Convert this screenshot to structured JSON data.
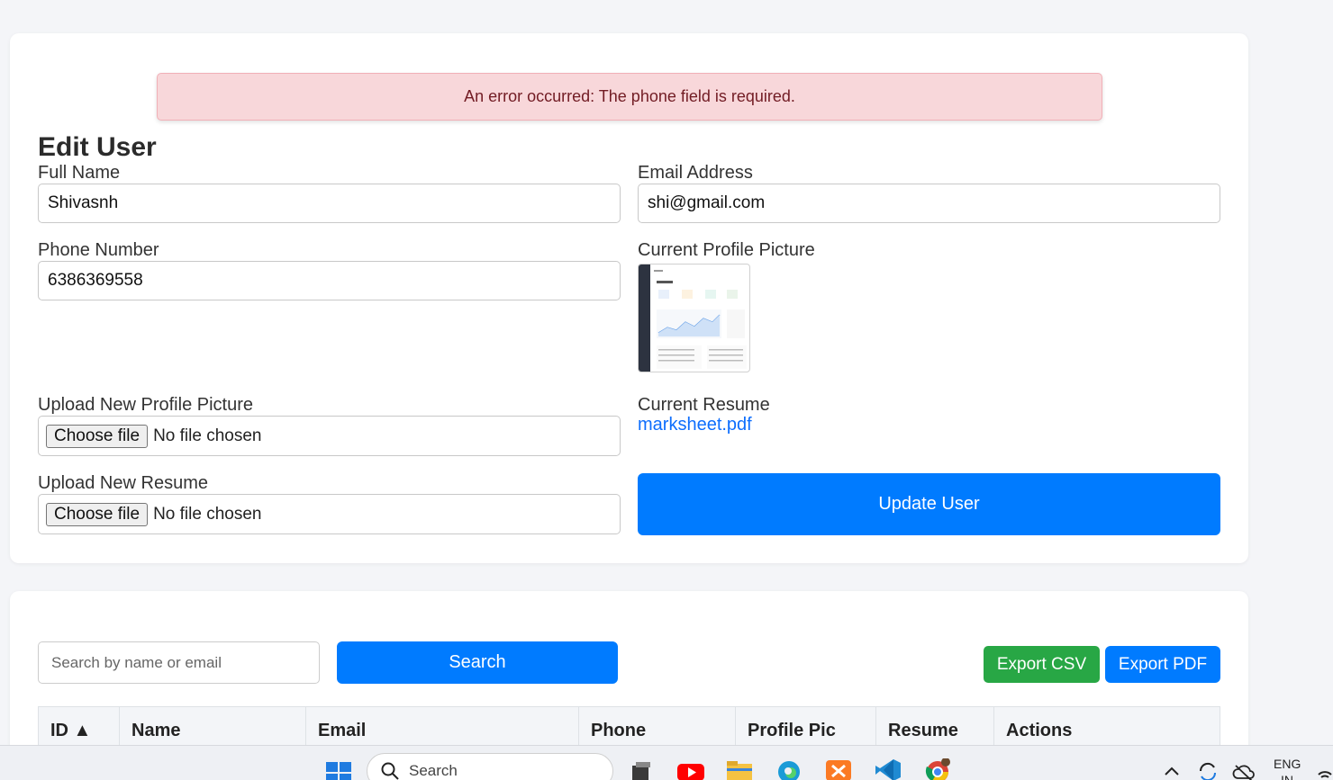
{
  "edit_form": {
    "alert": "An error occurred: The phone field is required.",
    "title": "Edit User",
    "full_name_label": "Full Name",
    "full_name_value": "Shivasnh",
    "email_label": "Email Address",
    "email_value": "shi@gmail.com",
    "phone_label": "Phone Number",
    "phone_value": "6386369558",
    "current_pic_label": "Current Profile Picture",
    "upload_pic_label": "Upload New Profile Picture",
    "current_resume_label": "Current Resume",
    "resume_link": "marksheet.pdf",
    "upload_resume_label": "Upload New Resume",
    "choose_file": "Choose file",
    "no_file": "No file chosen",
    "update_button": "Update User"
  },
  "table_section": {
    "search_placeholder": "Search by name or email",
    "search_button": "Search",
    "export_csv": "Export CSV",
    "export_pdf": "Export PDF",
    "columns": [
      "ID ▲",
      "Name",
      "Email",
      "Phone",
      "Profile Pic",
      "Resume",
      "Actions"
    ]
  },
  "taskbar": {
    "search_placeholder": "Search",
    "language": "ENG",
    "region": "IN"
  },
  "colors": {
    "primary": "#007bff",
    "success": "#28a745",
    "alert_bg": "#f8d7da",
    "alert_text": "#721c24"
  }
}
